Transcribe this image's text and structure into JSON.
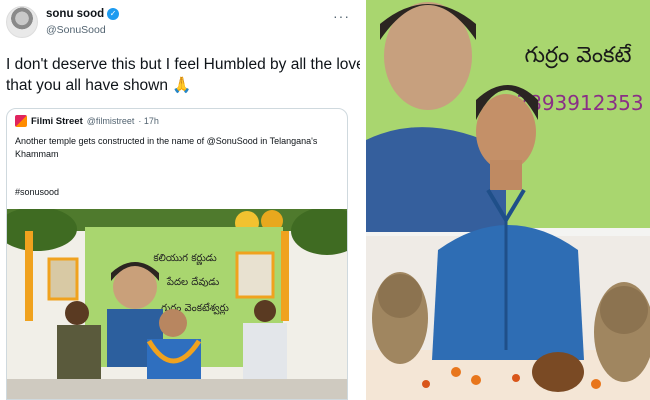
{
  "tweet": {
    "author": {
      "name": "sonu sood",
      "handle": "@SonuSood",
      "verified_icon": "verified-badge-icon"
    },
    "more_label": "···",
    "text_lines": [
      "I don't deserve this but I feel Humbled by all the love",
      "that you all have shown 🙏"
    ],
    "quoted": {
      "name": "Filmi Street",
      "handle": "@filmistreet",
      "time": "· 17h",
      "text_lines": [
        "Another temple gets constructed in the name of @SonuSood in Telangana's",
        "Khammam"
      ],
      "hashtag": "#sonusood",
      "image_banner_lines": [
        "కలియుగ కర్ణుడు",
        "పేదల దేవుడు",
        "గుర్రం వెంకటేశ్వర్లు"
      ]
    }
  },
  "photo": {
    "banner_lines": [
      "గుర్రం వెంకటే",
      "7893912353"
    ]
  },
  "colors": {
    "accent_blue": "#1d9bf0",
    "banner_green": "#a9d66f",
    "bust_blue": "#2e6db4"
  }
}
